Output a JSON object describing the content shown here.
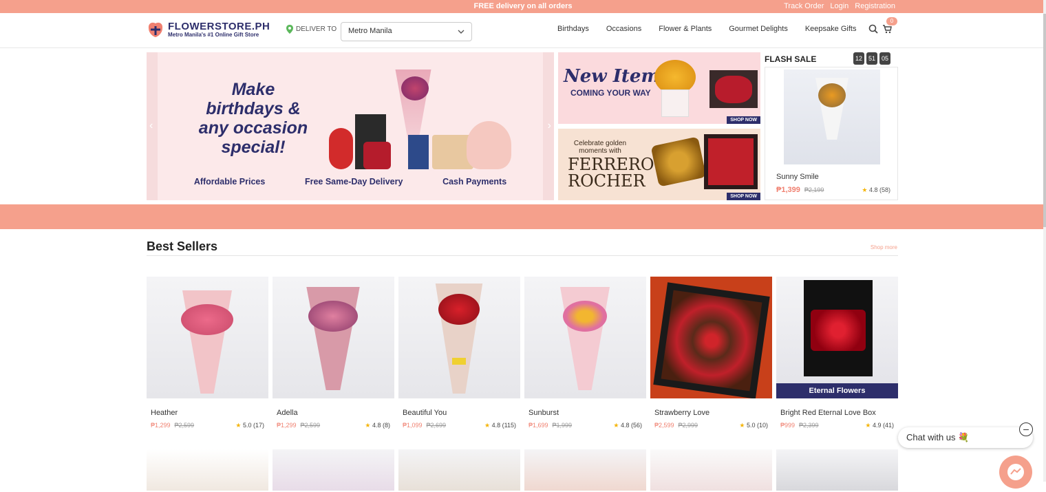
{
  "topbar": {
    "promo": "FREE delivery on all orders",
    "links": [
      "Track Order",
      "Login",
      "Registration"
    ]
  },
  "header": {
    "brand": "FLOWERSTORE.PH",
    "tagline": "Metro Manila's #1 Online Gift Store",
    "deliver_label": "DELIVER TO",
    "location": "Metro Manila",
    "nav": [
      "Birthdays",
      "Occasions",
      "Flower & Plants",
      "Gourmet Delights",
      "Keepsake Gifts"
    ],
    "cart_count": "0"
  },
  "hero": {
    "headline_lines": [
      "Make",
      "birthdays &",
      "any occasion",
      "special!"
    ],
    "perks": [
      "Affordable Prices",
      "Free Same-Day Delivery",
      "Cash Payments"
    ]
  },
  "promo1": {
    "title": "New Items",
    "subtitle": "COMING YOUR WAY",
    "cta": "SHOP NOW"
  },
  "promo2": {
    "pre": "Celebrate golden moments with",
    "brand_line1": "FERRERO",
    "brand_line2": "ROCHER",
    "cta": "SHOP NOW"
  },
  "flash_sale": {
    "title": "FLASH SALE",
    "timer": [
      "12",
      "51",
      "05"
    ],
    "product": {
      "name": "Sunny Smile",
      "price": "₱1,399",
      "old_price": "₱2,199",
      "rating": "4.8 (58)"
    }
  },
  "best_sellers": {
    "title": "Best Sellers",
    "shop_more": "Shop more",
    "products": [
      {
        "name": "Heather",
        "price": "₱1,299",
        "old_price": "₱2,599",
        "rating": "5.0 (17)"
      },
      {
        "name": "Adella",
        "price": "₱1,299",
        "old_price": "₱2,599",
        "rating": "4.8 (8)"
      },
      {
        "name": "Beautiful You",
        "price": "₱1,099",
        "old_price": "₱2,699",
        "rating": "4.8 (115)"
      },
      {
        "name": "Sunburst",
        "price": "₱1,699",
        "old_price": "₱1,999",
        "rating": "4.8 (56)"
      },
      {
        "name": "Strawberry Love",
        "price": "₱2,599",
        "old_price": "₱2,999",
        "rating": "5.0 (10)"
      },
      {
        "name": "Bright Red Eternal Love Box",
        "price": "₱999",
        "old_price": "₱2,399",
        "rating": "4.9 (41)",
        "badge": "Eternal Flowers"
      }
    ]
  },
  "chat": {
    "label": "Chat with us"
  },
  "colors": {
    "accent": "#f5a08c",
    "brand": "#2d2e6b",
    "price": "#f08070"
  }
}
